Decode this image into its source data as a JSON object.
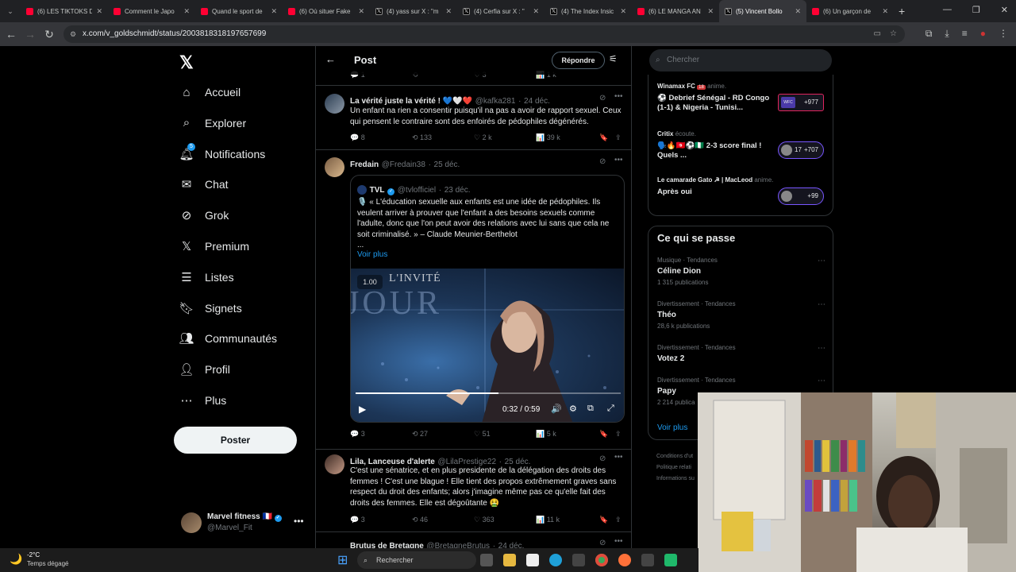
{
  "browser": {
    "tabs": [
      {
        "title": "(6) LES TIKTOKS D",
        "icon": "youtube-icon"
      },
      {
        "title": "Comment le Japo",
        "icon": "youtube-icon"
      },
      {
        "title": "Quand le sport de",
        "icon": "youtube-icon"
      },
      {
        "title": "(6) Où situer Fake",
        "icon": "youtube-icon"
      },
      {
        "title": "(4) yass sur X : \"m",
        "icon": "x-icon"
      },
      {
        "title": "(4) Cerfia sur X : \"",
        "icon": "x-icon"
      },
      {
        "title": "(4) The Index Insic",
        "icon": "x-icon"
      },
      {
        "title": "(6) LE MANGA AN",
        "icon": "youtube-icon"
      },
      {
        "title": "(5) Vincent Bollo",
        "icon": "x-icon"
      },
      {
        "title": "(6) Un garçon de",
        "icon": "youtube-icon"
      }
    ],
    "url": "x.com/v_goldschmidt/status/2003818318197657699"
  },
  "sidebar": {
    "items": [
      {
        "label": "Accueil",
        "icon": "home-icon"
      },
      {
        "label": "Explorer",
        "icon": "search-icon"
      },
      {
        "label": "Notifications",
        "icon": "bell-icon",
        "badge": "5"
      },
      {
        "label": "Chat",
        "icon": "mail-icon"
      },
      {
        "label": "Grok",
        "icon": "grok-icon"
      },
      {
        "label": "Premium",
        "icon": "x-premium-icon"
      },
      {
        "label": "Listes",
        "icon": "list-icon"
      },
      {
        "label": "Signets",
        "icon": "bookmark-icon"
      },
      {
        "label": "Communautés",
        "icon": "communities-icon"
      },
      {
        "label": "Profil",
        "icon": "person-icon"
      },
      {
        "label": "Plus",
        "icon": "more-circle-icon"
      }
    ],
    "post_button": "Poster",
    "account": {
      "name": "Marvel fitness",
      "flag": "🇫🇷",
      "handle": "@Marvel_Fit"
    }
  },
  "main": {
    "title": "Post",
    "reply_button": "Répondre",
    "top_stats": [
      "1",
      "",
      "3",
      "1 k"
    ],
    "tweets": [
      {
        "name": "La vérité juste la vérité ! 💙🤍❤️",
        "handle": "@kafka281",
        "date": "24 déc.",
        "text": "Un enfant na rien a consentir puisqu'il na pas a avoir de rapport sexuel. Ceux qui pensent le contraire sont des enfoirés de pédophiles dégénérés.",
        "stats": {
          "replies": "8",
          "retweets": "133",
          "likes": "2 k",
          "views": "39 k"
        }
      },
      {
        "name": "Fredain",
        "handle": "@Fredain38",
        "date": "25 déc.",
        "quote": {
          "name": "TVL",
          "handle": "@tvlofficiel",
          "date": "23 déc.",
          "text": "🎙️ « L'éducation sexuelle aux enfants est une idée de pédophiles. Ils veulent arriver à prouver que l'enfant a des besoins sexuels comme l'adulte, donc que l'on peut avoir des relations avec lui sans que cela ne soit criminalisé. » – Claude Meunier-Berthelot",
          "ellipsis": "...",
          "see_more": "Voir plus"
        },
        "video": {
          "speed": "1.00",
          "overlay_text": "L'INVITÉ",
          "overlay_big": "JOUR",
          "time": "0:32 / 0:59",
          "progress": 0.54
        },
        "stats": {
          "replies": "3",
          "retweets": "27",
          "likes": "51",
          "views": "5 k"
        }
      },
      {
        "name": "Lila, Lanceuse d'alerte",
        "handle": "@LilaPrestige22",
        "date": "25 déc.",
        "text": "C'est une sénatrice, et en plus presidente de la délégation des droits des femmes ! C'est une blague ! Elle tient des propos extrêmement graves sans respect du droit des enfants; alors j'imagine même pas ce qu'elle fait des droits des femmes. Elle est dégoûtante 🤮",
        "stats": {
          "replies": "3",
          "retweets": "46",
          "likes": "363",
          "views": "11 k"
        }
      },
      {
        "name": "Brutus de Bretagne",
        "handle": "@BretagneBrutus",
        "date": "24 déc."
      }
    ]
  },
  "right": {
    "search_placeholder": "Chercher",
    "spaces": [
      {
        "host": "Winamax FC",
        "host_badge": "18",
        "status": "anime.",
        "title": "⚽ Debrief Sénégal - RD Congo (1-1) & Nigeria - Tunisi...",
        "count": "+977",
        "tag": "WFC"
      },
      {
        "host": "Critix",
        "status": "écoute.",
        "title": "🗣️🔥🇹🇳⚽🇳🇬 2-3 score final ! Quels ...",
        "count": "+707",
        "count_prefix": "17"
      },
      {
        "host": "Le camarade Gato ☭ | MacLeod",
        "status": "anime.",
        "title": "Après oui",
        "count": "+99"
      }
    ],
    "trends_title": "Ce qui se passe",
    "trends": [
      {
        "category": "Musique · Tendances",
        "topic": "Céline Dion",
        "count": "1 315 publications"
      },
      {
        "category": "Divertissement · Tendances",
        "topic": "Théo",
        "count": "28,6 k publications"
      },
      {
        "category": "Divertissement · Tendances",
        "topic": "Votez 2",
        "count": ""
      },
      {
        "category": "Divertissement · Tendances",
        "topic": "Papy",
        "count": "2 214 publica"
      }
    ],
    "see_more": "Voir plus",
    "footer": [
      "Conditions d'ut",
      "Politique relati",
      "Informations su"
    ]
  },
  "taskbar": {
    "weather_temp": "-2°C",
    "weather_desc": "Temps dégagé",
    "search_placeholder": "Rechercher"
  }
}
